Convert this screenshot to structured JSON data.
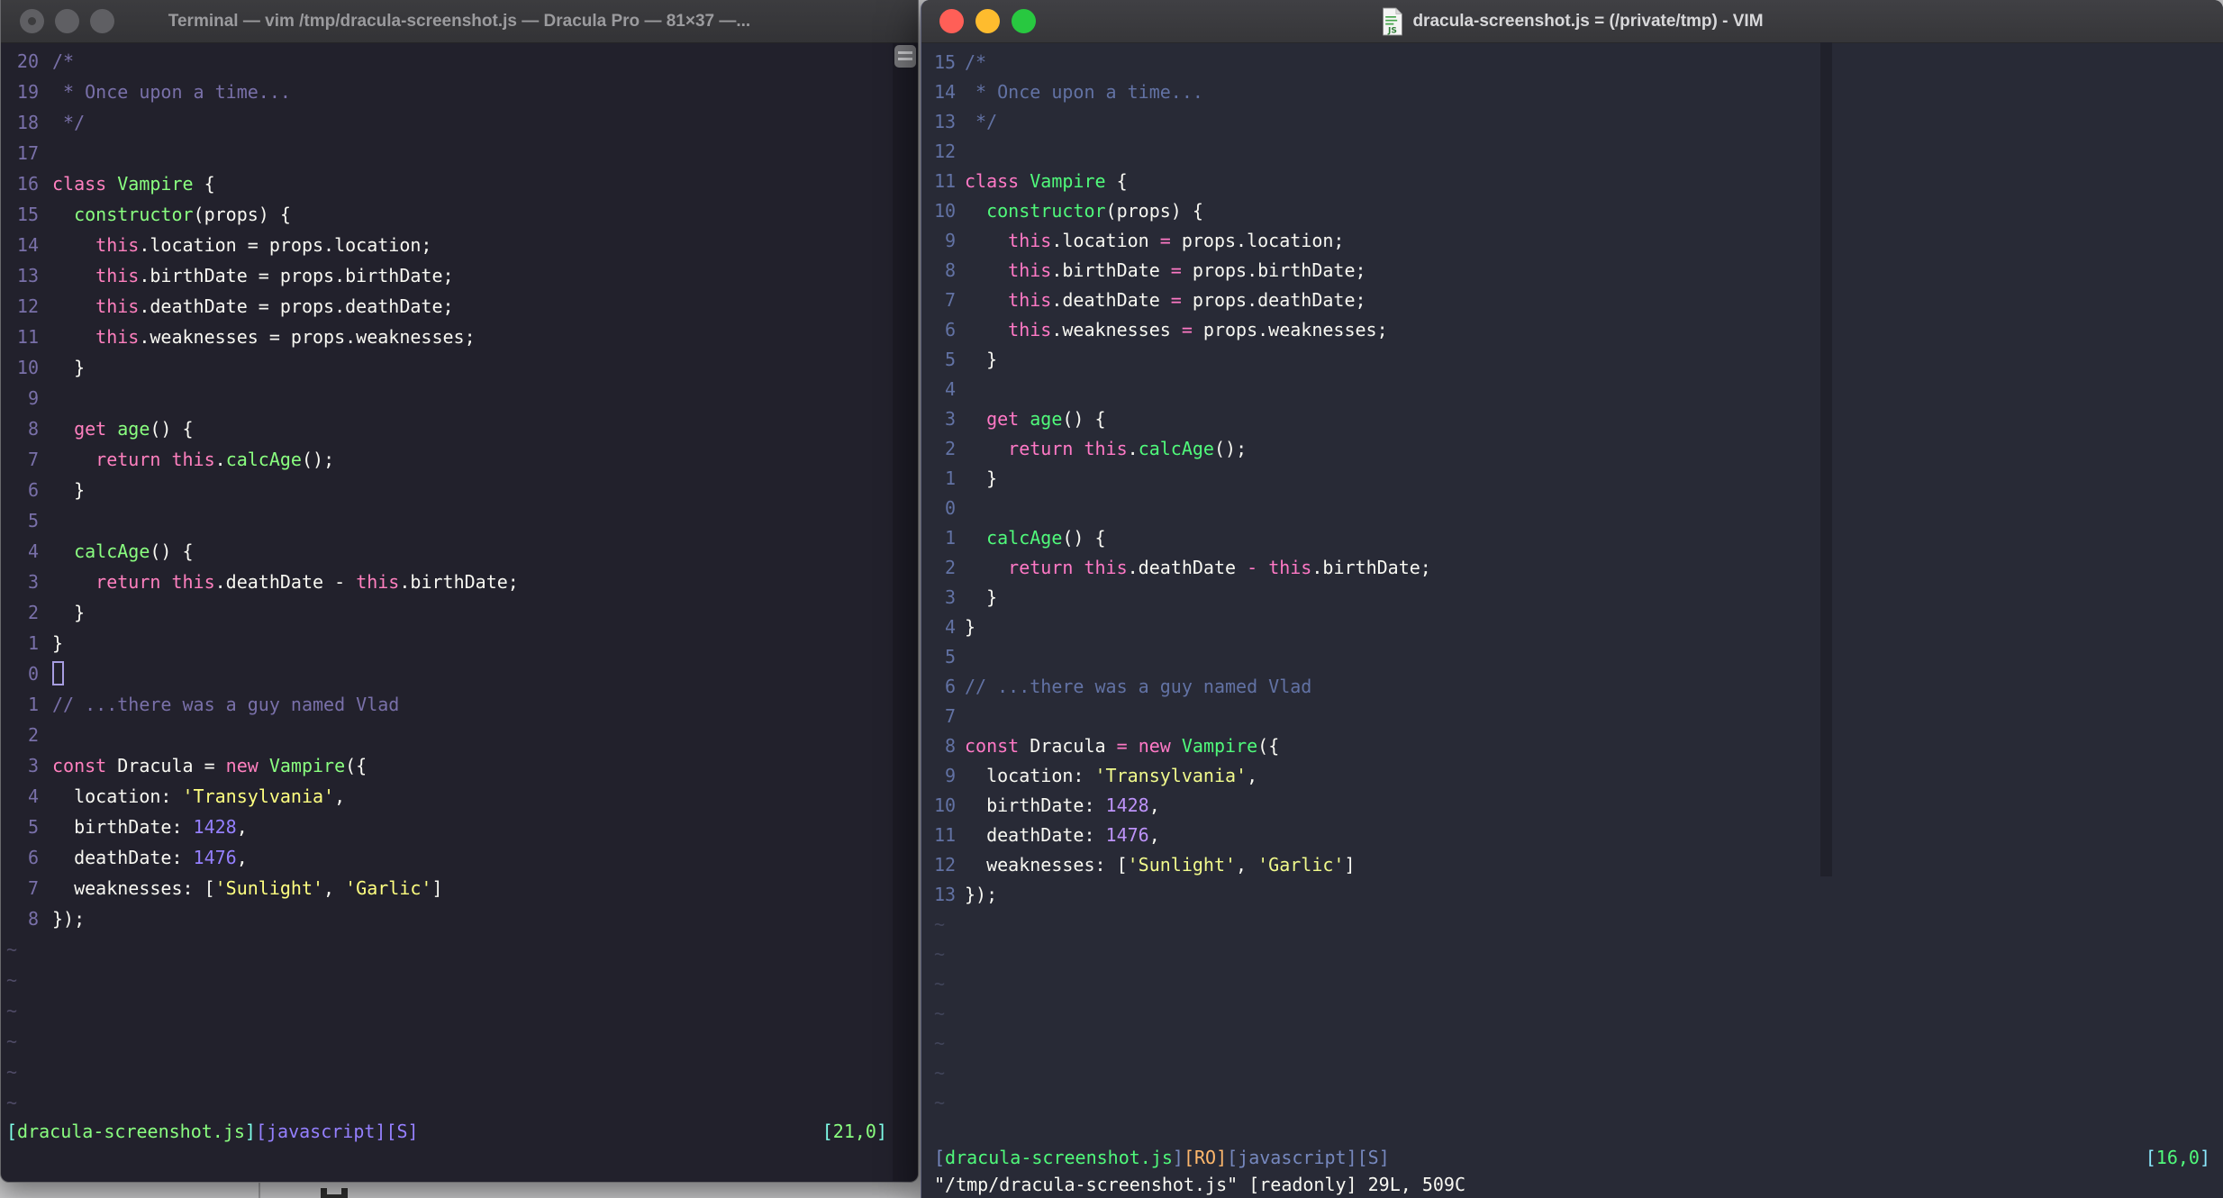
{
  "desktop": {
    "background_color": "#C9C9CB",
    "letter_fragment": "H"
  },
  "left_window": {
    "title": "Terminal — vim /tmp/dracula-screenshot.js — Dracula Pro — 81×37 —...",
    "theme_name": "Dracula Pro",
    "palette": {
      "bg": "#22212C",
      "fg": "#F8F8F2",
      "comment": "#7970A9",
      "pink": "#FF80BF",
      "green": "#8AFF80",
      "purple": "#9580FF",
      "yellow": "#FFFF80",
      "cyan": "#80FFEA"
    },
    "cursor_position": "[21,0]",
    "tilde_count": 6,
    "command_line": "",
    "status_left": [
      [
        "cy",
        "["
      ],
      [
        "gr",
        "dracula-screenshot.js"
      ],
      [
        "cy",
        "]"
      ],
      [
        "pu",
        "[javascript][S]"
      ]
    ],
    "status_right": [
      [
        "cy",
        "["
      ],
      [
        "gr",
        "21,0"
      ],
      [
        "cy",
        "]"
      ]
    ],
    "lines": [
      {
        "n": "20",
        "s": [
          [
            "com",
            "/*"
          ]
        ]
      },
      {
        "n": "19",
        "s": [
          [
            "com",
            " * Once upon a time..."
          ]
        ]
      },
      {
        "n": "18",
        "s": [
          [
            "com",
            " */"
          ]
        ]
      },
      {
        "n": "17",
        "s": []
      },
      {
        "n": "16",
        "s": [
          [
            "k",
            "class"
          ],
          [
            "fg",
            " "
          ],
          [
            "fn",
            "Vampire"
          ],
          [
            "fg",
            " {"
          ]
        ]
      },
      {
        "n": "15",
        "s": [
          [
            "fg",
            "  "
          ],
          [
            "fn",
            "constructor"
          ],
          [
            "fg",
            "(props) {"
          ]
        ]
      },
      {
        "n": "14",
        "s": [
          [
            "fg",
            "    "
          ],
          [
            "k",
            "this"
          ],
          [
            "fg",
            ".location = props.location;"
          ]
        ]
      },
      {
        "n": "13",
        "s": [
          [
            "fg",
            "    "
          ],
          [
            "k",
            "this"
          ],
          [
            "fg",
            ".birthDate = props.birthDate;"
          ]
        ]
      },
      {
        "n": "12",
        "s": [
          [
            "fg",
            "    "
          ],
          [
            "k",
            "this"
          ],
          [
            "fg",
            ".deathDate = props.deathDate;"
          ]
        ]
      },
      {
        "n": "11",
        "s": [
          [
            "fg",
            "    "
          ],
          [
            "k",
            "this"
          ],
          [
            "fg",
            ".weaknesses = props.weaknesses;"
          ]
        ]
      },
      {
        "n": "10",
        "s": [
          [
            "fg",
            "  }"
          ]
        ]
      },
      {
        "n": " 9",
        "s": []
      },
      {
        "n": " 8",
        "s": [
          [
            "fg",
            "  "
          ],
          [
            "k",
            "get"
          ],
          [
            "fg",
            " "
          ],
          [
            "fn",
            "age"
          ],
          [
            "fg",
            "() {"
          ]
        ]
      },
      {
        "n": " 7",
        "s": [
          [
            "fg",
            "    "
          ],
          [
            "k",
            "return"
          ],
          [
            "fg",
            " "
          ],
          [
            "k",
            "this"
          ],
          [
            "fg",
            "."
          ],
          [
            "fn",
            "calcAge"
          ],
          [
            "fg",
            "();"
          ]
        ]
      },
      {
        "n": " 6",
        "s": [
          [
            "fg",
            "  }"
          ]
        ]
      },
      {
        "n": " 5",
        "s": []
      },
      {
        "n": " 4",
        "s": [
          [
            "fg",
            "  "
          ],
          [
            "fn",
            "calcAge"
          ],
          [
            "fg",
            "() {"
          ]
        ]
      },
      {
        "n": " 3",
        "s": [
          [
            "fg",
            "    "
          ],
          [
            "k",
            "return"
          ],
          [
            "fg",
            " "
          ],
          [
            "k",
            "this"
          ],
          [
            "fg",
            ".deathDate - "
          ],
          [
            "k",
            "this"
          ],
          [
            "fg",
            ".birthDate;"
          ]
        ]
      },
      {
        "n": " 2",
        "s": [
          [
            "fg",
            "  }"
          ]
        ]
      },
      {
        "n": " 1",
        "s": [
          [
            "fg",
            "}"
          ]
        ]
      },
      {
        "n": " 0",
        "s": [
          [
            "cur",
            ""
          ]
        ]
      },
      {
        "n": " 1",
        "s": [
          [
            "com",
            "// ...there was a guy named Vlad"
          ]
        ]
      },
      {
        "n": " 2",
        "s": []
      },
      {
        "n": " 3",
        "s": [
          [
            "k",
            "const"
          ],
          [
            "fg",
            " Dracula = "
          ],
          [
            "k",
            "new"
          ],
          [
            "fg",
            " "
          ],
          [
            "fn",
            "Vampire"
          ],
          [
            "fg",
            "({"
          ]
        ]
      },
      {
        "n": " 4",
        "s": [
          [
            "fg",
            "  location: "
          ],
          [
            "str",
            "'Transylvania'"
          ],
          [
            "fg",
            ","
          ]
        ]
      },
      {
        "n": " 5",
        "s": [
          [
            "fg",
            "  birthDate: "
          ],
          [
            "num",
            "1428"
          ],
          [
            "fg",
            ","
          ]
        ]
      },
      {
        "n": " 6",
        "s": [
          [
            "fg",
            "  deathDate: "
          ],
          [
            "num",
            "1476"
          ],
          [
            "fg",
            ","
          ]
        ]
      },
      {
        "n": " 7",
        "s": [
          [
            "fg",
            "  weaknesses: ["
          ],
          [
            "str",
            "'Sunlight'"
          ],
          [
            "fg",
            ", "
          ],
          [
            "str",
            "'Garlic'"
          ],
          [
            "fg",
            "]"
          ]
        ]
      },
      {
        "n": " 8",
        "s": [
          [
            "fg",
            "});"
          ]
        ]
      }
    ]
  },
  "right_window": {
    "title": "dracula-screenshot.js = (/private/tmp) - VIM",
    "icon": "js-file",
    "palette": {
      "bg": "#282A36",
      "fg": "#F8F8F2",
      "comment": "#6272A4",
      "pink": "#FF79C6",
      "green": "#50FA7B",
      "purple": "#BD93F9",
      "yellow": "#F1FA8C",
      "orange": "#FFB86C",
      "cyan": "#8BE9FD"
    },
    "cursor_position": "[16,0]",
    "tilde_count": 7,
    "command_line": "\"/tmp/dracula-screenshot.js\" [readonly] 29L, 509C",
    "status_left": [
      [
        "bl",
        "["
      ],
      [
        "gr",
        "dracula-screenshot.js"
      ],
      [
        "bl",
        "]"
      ],
      [
        "or",
        "[RO]"
      ],
      [
        "bl",
        "[javascript][S]"
      ]
    ],
    "status_right": [
      [
        "cy",
        "["
      ],
      [
        "gr",
        "16,0"
      ],
      [
        "cy",
        "]"
      ]
    ],
    "lines": [
      {
        "n": "15",
        "s": [
          [
            "com",
            "/*"
          ]
        ]
      },
      {
        "n": "14",
        "s": [
          [
            "com",
            " * Once upon a time..."
          ]
        ]
      },
      {
        "n": "13",
        "s": [
          [
            "com",
            " */"
          ]
        ]
      },
      {
        "n": "12",
        "s": []
      },
      {
        "n": "11",
        "s": [
          [
            "k",
            "class"
          ],
          [
            "fg",
            " "
          ],
          [
            "fn",
            "Vampire"
          ],
          [
            "fg",
            " {"
          ]
        ]
      },
      {
        "n": "10",
        "s": [
          [
            "fg",
            "  "
          ],
          [
            "fn",
            "constructor"
          ],
          [
            "fg",
            "(props) {"
          ]
        ]
      },
      {
        "n": " 9",
        "s": [
          [
            "fg",
            "    "
          ],
          [
            "k",
            "this"
          ],
          [
            "fg",
            ".location "
          ],
          [
            "k",
            "="
          ],
          [
            "fg",
            " props.location;"
          ]
        ]
      },
      {
        "n": " 8",
        "s": [
          [
            "fg",
            "    "
          ],
          [
            "k",
            "this"
          ],
          [
            "fg",
            ".birthDate "
          ],
          [
            "k",
            "="
          ],
          [
            "fg",
            " props.birthDate;"
          ]
        ]
      },
      {
        "n": " 7",
        "s": [
          [
            "fg",
            "    "
          ],
          [
            "k",
            "this"
          ],
          [
            "fg",
            ".deathDate "
          ],
          [
            "k",
            "="
          ],
          [
            "fg",
            " props.deathDate;"
          ]
        ]
      },
      {
        "n": " 6",
        "s": [
          [
            "fg",
            "    "
          ],
          [
            "k",
            "this"
          ],
          [
            "fg",
            ".weaknesses "
          ],
          [
            "k",
            "="
          ],
          [
            "fg",
            " props.weaknesses;"
          ]
        ]
      },
      {
        "n": " 5",
        "s": [
          [
            "fg",
            "  }"
          ]
        ]
      },
      {
        "n": " 4",
        "s": []
      },
      {
        "n": " 3",
        "s": [
          [
            "fg",
            "  "
          ],
          [
            "k",
            "get"
          ],
          [
            "fg",
            " "
          ],
          [
            "fn",
            "age"
          ],
          [
            "fg",
            "() {"
          ]
        ]
      },
      {
        "n": " 2",
        "s": [
          [
            "fg",
            "    "
          ],
          [
            "k",
            "return"
          ],
          [
            "fg",
            " "
          ],
          [
            "k",
            "this"
          ],
          [
            "fg",
            "."
          ],
          [
            "fn",
            "calcAge"
          ],
          [
            "fg",
            "();"
          ]
        ]
      },
      {
        "n": " 1",
        "s": [
          [
            "fg",
            "  }"
          ]
        ]
      },
      {
        "n": " 0",
        "s": []
      },
      {
        "n": " 1",
        "s": [
          [
            "fg",
            "  "
          ],
          [
            "fn",
            "calcAge"
          ],
          [
            "fg",
            "() {"
          ]
        ]
      },
      {
        "n": " 2",
        "s": [
          [
            "fg",
            "    "
          ],
          [
            "k",
            "return"
          ],
          [
            "fg",
            " "
          ],
          [
            "k",
            "this"
          ],
          [
            "fg",
            ".deathDate "
          ],
          [
            "k",
            "-"
          ],
          [
            "fg",
            " "
          ],
          [
            "k",
            "this"
          ],
          [
            "fg",
            ".birthDate;"
          ]
        ]
      },
      {
        "n": " 3",
        "s": [
          [
            "fg",
            "  }"
          ]
        ]
      },
      {
        "n": " 4",
        "s": [
          [
            "fg",
            "}"
          ]
        ]
      },
      {
        "n": " 5",
        "s": []
      },
      {
        "n": " 6",
        "s": [
          [
            "com",
            "// ...there was a guy named Vlad"
          ]
        ]
      },
      {
        "n": " 7",
        "s": []
      },
      {
        "n": " 8",
        "s": [
          [
            "k",
            "const"
          ],
          [
            "fg",
            " Dracula "
          ],
          [
            "k",
            "="
          ],
          [
            "fg",
            " "
          ],
          [
            "k",
            "new"
          ],
          [
            "fg",
            " "
          ],
          [
            "fn",
            "Vampire"
          ],
          [
            "fg",
            "({"
          ]
        ]
      },
      {
        "n": " 9",
        "s": [
          [
            "fg",
            "  location: "
          ],
          [
            "str",
            "'Transylvania'"
          ],
          [
            "fg",
            ","
          ]
        ]
      },
      {
        "n": "10",
        "s": [
          [
            "fg",
            "  birthDate: "
          ],
          [
            "num",
            "1428"
          ],
          [
            "fg",
            ","
          ]
        ]
      },
      {
        "n": "11",
        "s": [
          [
            "fg",
            "  deathDate: "
          ],
          [
            "num",
            "1476"
          ],
          [
            "fg",
            ","
          ]
        ]
      },
      {
        "n": "12",
        "s": [
          [
            "fg",
            "  weaknesses: ["
          ],
          [
            "str",
            "'Sunlight'"
          ],
          [
            "fg",
            ", "
          ],
          [
            "str",
            "'Garlic'"
          ],
          [
            "fg",
            "]"
          ]
        ]
      },
      {
        "n": "13",
        "s": [
          [
            "fg",
            "});"
          ]
        ]
      }
    ]
  }
}
